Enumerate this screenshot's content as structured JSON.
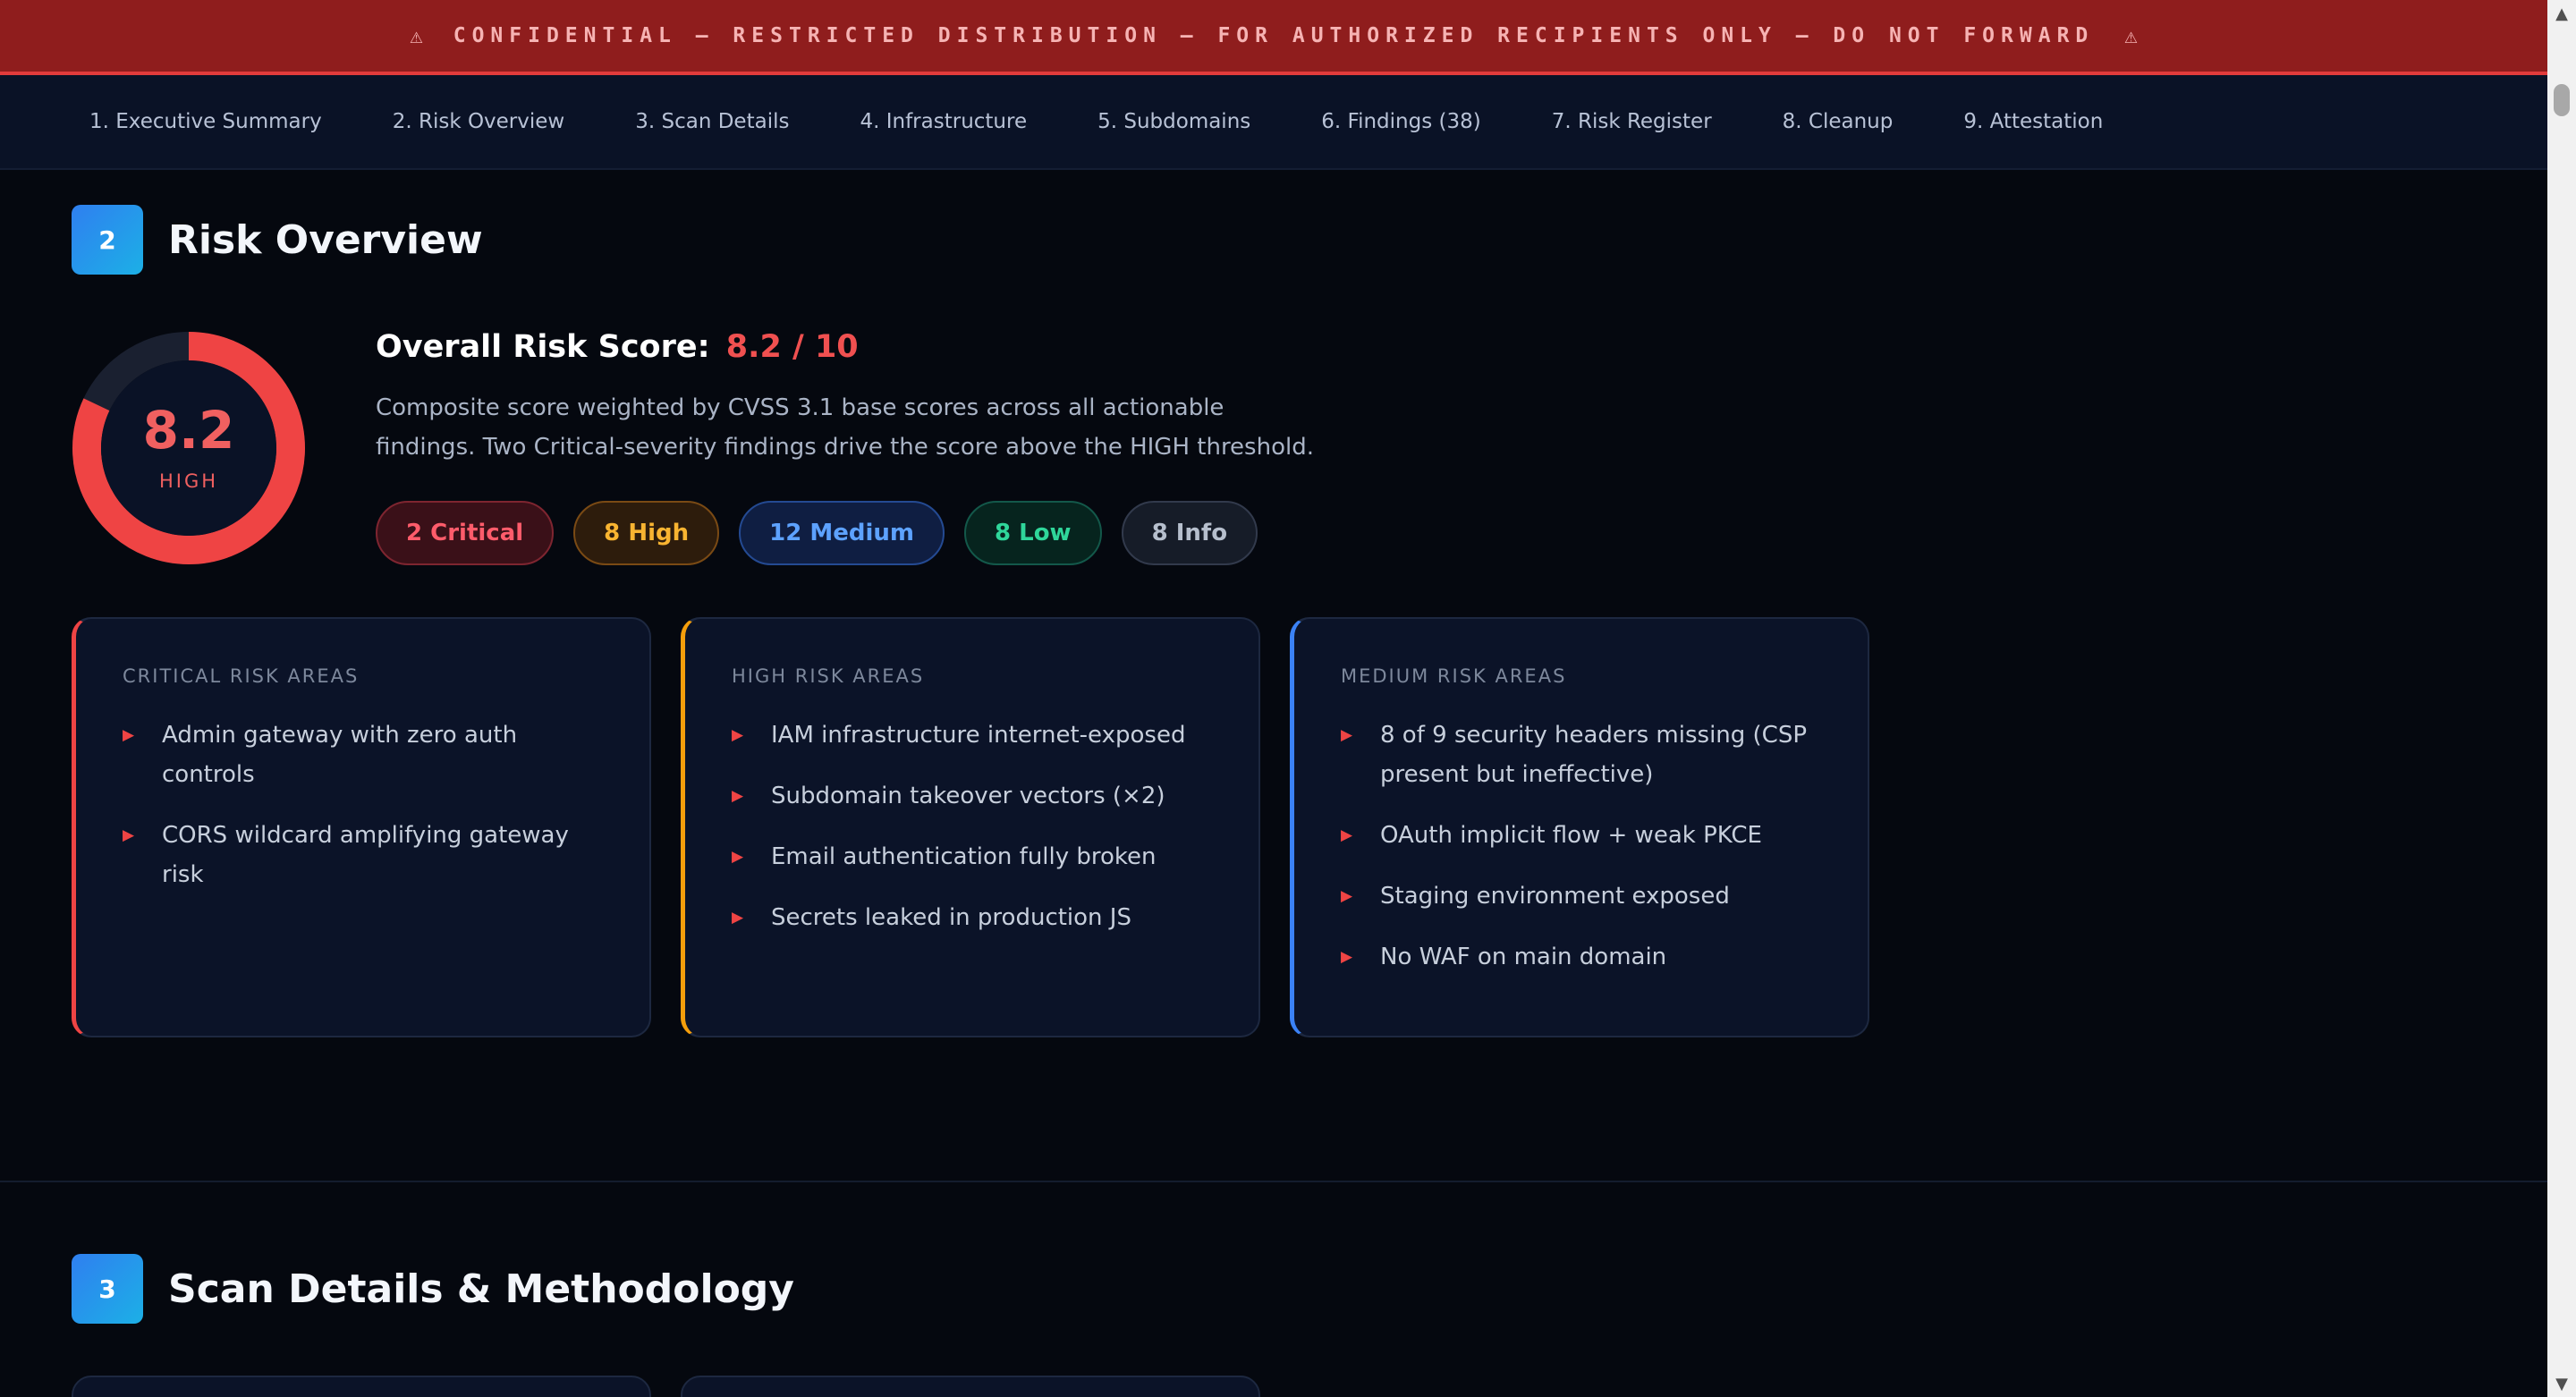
{
  "banner": {
    "icon": "warning-icon",
    "text": "CONFIDENTIAL — RESTRICTED DISTRIBUTION — FOR AUTHORIZED RECIPIENTS ONLY — DO NOT FORWARD",
    "warn_glyph": "⚠"
  },
  "nav": {
    "items": [
      {
        "label": "1. Executive Summary"
      },
      {
        "label": "2. Risk Overview"
      },
      {
        "label": "3. Scan Details"
      },
      {
        "label": "4. Infrastructure"
      },
      {
        "label": "5. Subdomains"
      },
      {
        "label": "6. Findings (38)"
      },
      {
        "label": "7. Risk Register"
      },
      {
        "label": "8. Cleanup"
      },
      {
        "label": "9. Attestation"
      }
    ]
  },
  "section2": {
    "number": "2",
    "title": "Risk Overview"
  },
  "gauge": {
    "score": "8.2",
    "label": "HIGH",
    "fraction": 0.82,
    "color": "#ef4444"
  },
  "risk": {
    "title_prefix": "Overall Risk Score:",
    "score_text": "8.2 / 10",
    "description": "Composite score weighted by CVSS 3.1 base scores across all actionable findings. Two Critical-severity findings drive the score above the HIGH threshold."
  },
  "pills": [
    {
      "label": "2 Critical",
      "kind": "critical"
    },
    {
      "label": "8 High",
      "kind": "high"
    },
    {
      "label": "12 Medium",
      "kind": "medium"
    },
    {
      "label": "8 Low",
      "kind": "low"
    },
    {
      "label": "8 Info",
      "kind": "info"
    }
  ],
  "cards": [
    {
      "title": "CRITICAL RISK AREAS",
      "accent": "#ef4444",
      "items": [
        "Admin gateway with zero auth controls",
        "CORS wildcard amplifying gateway risk"
      ]
    },
    {
      "title": "HIGH RISK AREAS",
      "accent": "#f59e0b",
      "items": [
        "IAM infrastructure internet-exposed",
        "Subdomain takeover vectors (×2)",
        "Email authentication fully broken",
        "Secrets leaked in production JS"
      ]
    },
    {
      "title": "MEDIUM RISK AREAS",
      "accent": "#3b82f6",
      "items": [
        "8 of 9 security headers missing (CSP present but ineffective)",
        "OAuth implicit flow + weak PKCE",
        "Staging environment exposed",
        "No WAF on main domain"
      ]
    }
  ],
  "bullet_glyph": "▶",
  "section3": {
    "number": "3",
    "title": "Scan Details & Methodology"
  }
}
